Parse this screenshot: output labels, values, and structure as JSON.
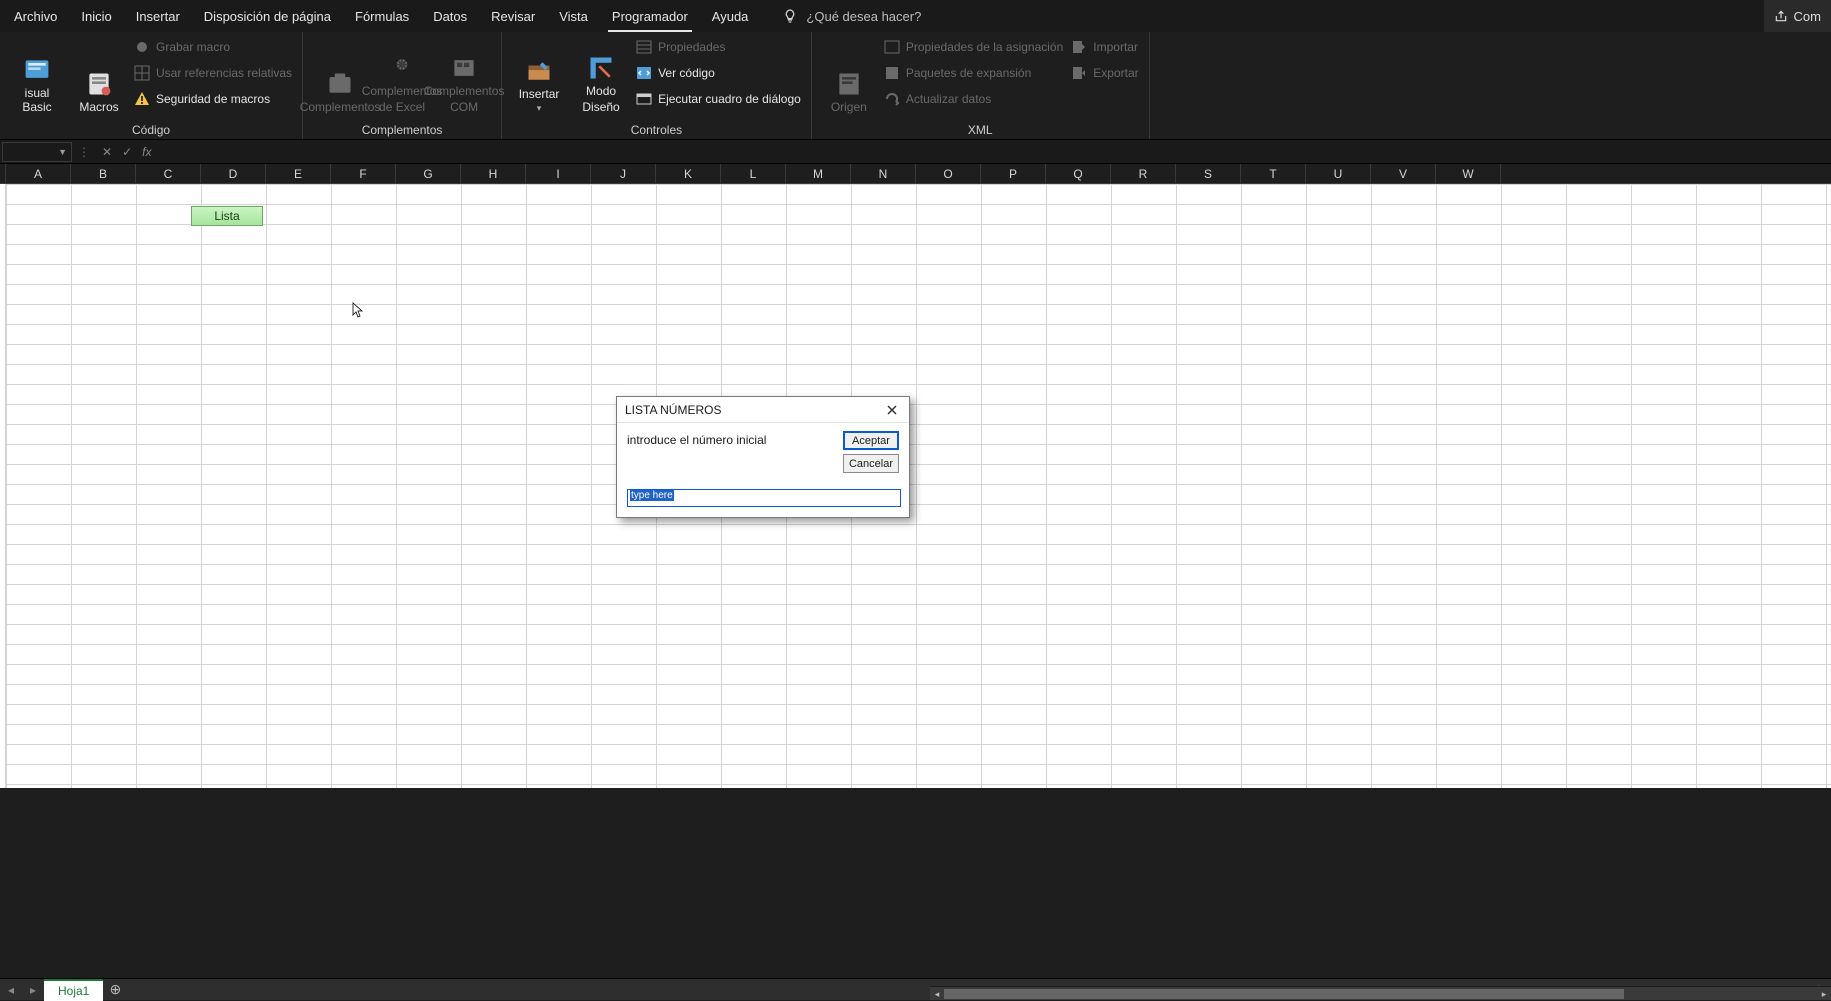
{
  "tabs": {
    "items": [
      "Archivo",
      "Inicio",
      "Insertar",
      "Disposición de página",
      "Fórmulas",
      "Datos",
      "Revisar",
      "Vista",
      "Programador",
      "Ayuda"
    ],
    "active_index": 8,
    "tellme": "¿Qué desea hacer?",
    "right_button": "Com"
  },
  "ribbon": {
    "codigo": {
      "label": "Código",
      "visual_basic": "isual Basic",
      "macros": "Macros",
      "grabar": "Grabar macro",
      "refs": "Usar referencias relativas",
      "seguridad": "Seguridad de macros"
    },
    "complementos": {
      "label": "Complementos",
      "a": "Complementos",
      "b1": "Complementos",
      "b2": "de Excel",
      "c1": "Complementos",
      "c2": "COM"
    },
    "controles": {
      "label": "Controles",
      "insertar": "Insertar",
      "modo1": "Modo",
      "modo2": "Diseño",
      "propiedades": "Propiedades",
      "ver_codigo": "Ver código",
      "ejecutar": "Ejecutar cuadro de diálogo"
    },
    "xml": {
      "label": "XML",
      "origen": "Origen",
      "prop_asig": "Propiedades de la asignación",
      "paquetes": "Paquetes de expansión",
      "actualizar": "Actualizar datos",
      "importar": "Importar",
      "exportar": "Exportar"
    }
  },
  "formula_bar": {
    "fx": "fx",
    "value": ""
  },
  "columns": [
    "A",
    "B",
    "C",
    "D",
    "E",
    "F",
    "G",
    "H",
    "I",
    "J",
    "K",
    "L",
    "M",
    "N",
    "O",
    "P",
    "Q",
    "R",
    "S",
    "T",
    "U",
    "V",
    "W"
  ],
  "sheet": {
    "lista_button": "Lista",
    "tab_name": "Hoja1"
  },
  "dialog": {
    "title": "LISTA NÚMEROS",
    "prompt": "introduce el número inicial",
    "accept": "Aceptar",
    "cancel": "Cancelar",
    "input_value": "type here"
  }
}
